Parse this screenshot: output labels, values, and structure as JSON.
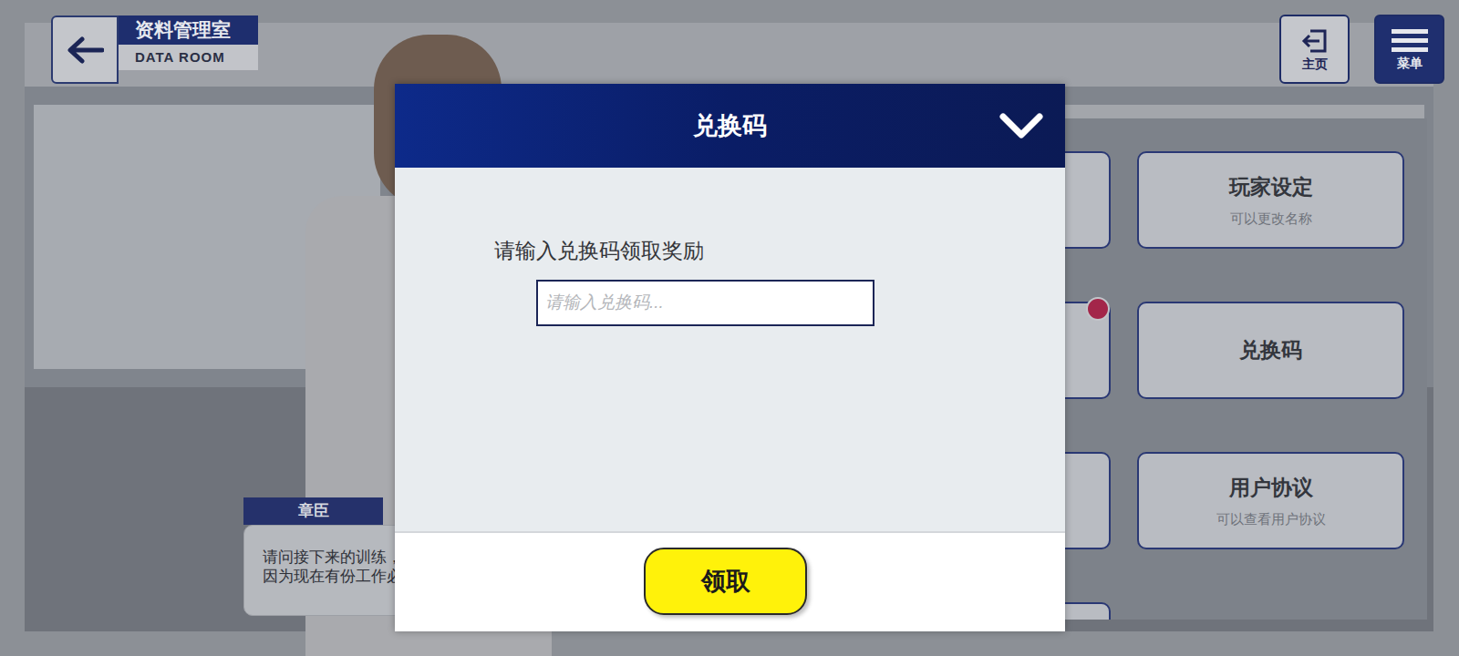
{
  "header": {
    "title": "资料管理室",
    "subtitle": "DATA ROOM"
  },
  "top_buttons": [
    {
      "label": "主页"
    },
    {
      "label": "菜单"
    }
  ],
  "menu_cards": [
    {
      "title": "",
      "description": "",
      "notification": false
    },
    {
      "title": "玩家设定",
      "description": "可以更改名称",
      "notification": false
    },
    {
      "title": "",
      "description": "",
      "notification": true
    },
    {
      "title": "兑换码",
      "description": "",
      "notification": false
    },
    {
      "title": "",
      "description": "",
      "notification": false
    },
    {
      "title": "用户协议",
      "description": "可以查看用户协议",
      "notification": false
    },
    {
      "title": "",
      "description": "",
      "notification": false
    }
  ],
  "dialogue": {
    "speaker": "章臣",
    "lines": [
      "请问接下来的训练，可以让我一起参加吗？",
      "因为现在有份工作必须要稍微和你聊一聊。"
    ]
  },
  "modal": {
    "title": "兑换码",
    "prompt": "请输入兑换码领取奖励",
    "input": {
      "placeholder": "请输入兑换码...",
      "value": ""
    },
    "button": "领取"
  }
}
